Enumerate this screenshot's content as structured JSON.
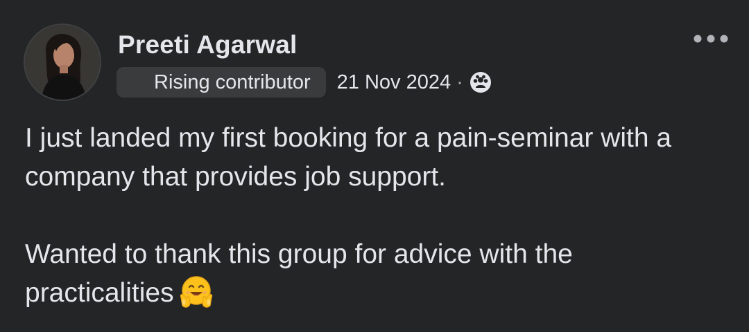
{
  "post": {
    "author": {
      "name": "Preeti Agarwal",
      "badge": "Rising contributor",
      "avatar_icon": "profile-photo"
    },
    "date": "21 Nov 2024",
    "separator": "·",
    "audience_icon": "group-members-icon",
    "more_icon": "ellipsis-icon",
    "paragraphs": [
      "I just landed my first booking for a pain-seminar with a company that provides job support.",
      "Wanted to thank this group for advice with the practicalities"
    ],
    "emoji": "hugging-face"
  },
  "colors": {
    "background": "#242526",
    "text": "#e4e6eb",
    "badge_bg": "#3a3b3c",
    "secondary_text": "#b0b3b8"
  }
}
